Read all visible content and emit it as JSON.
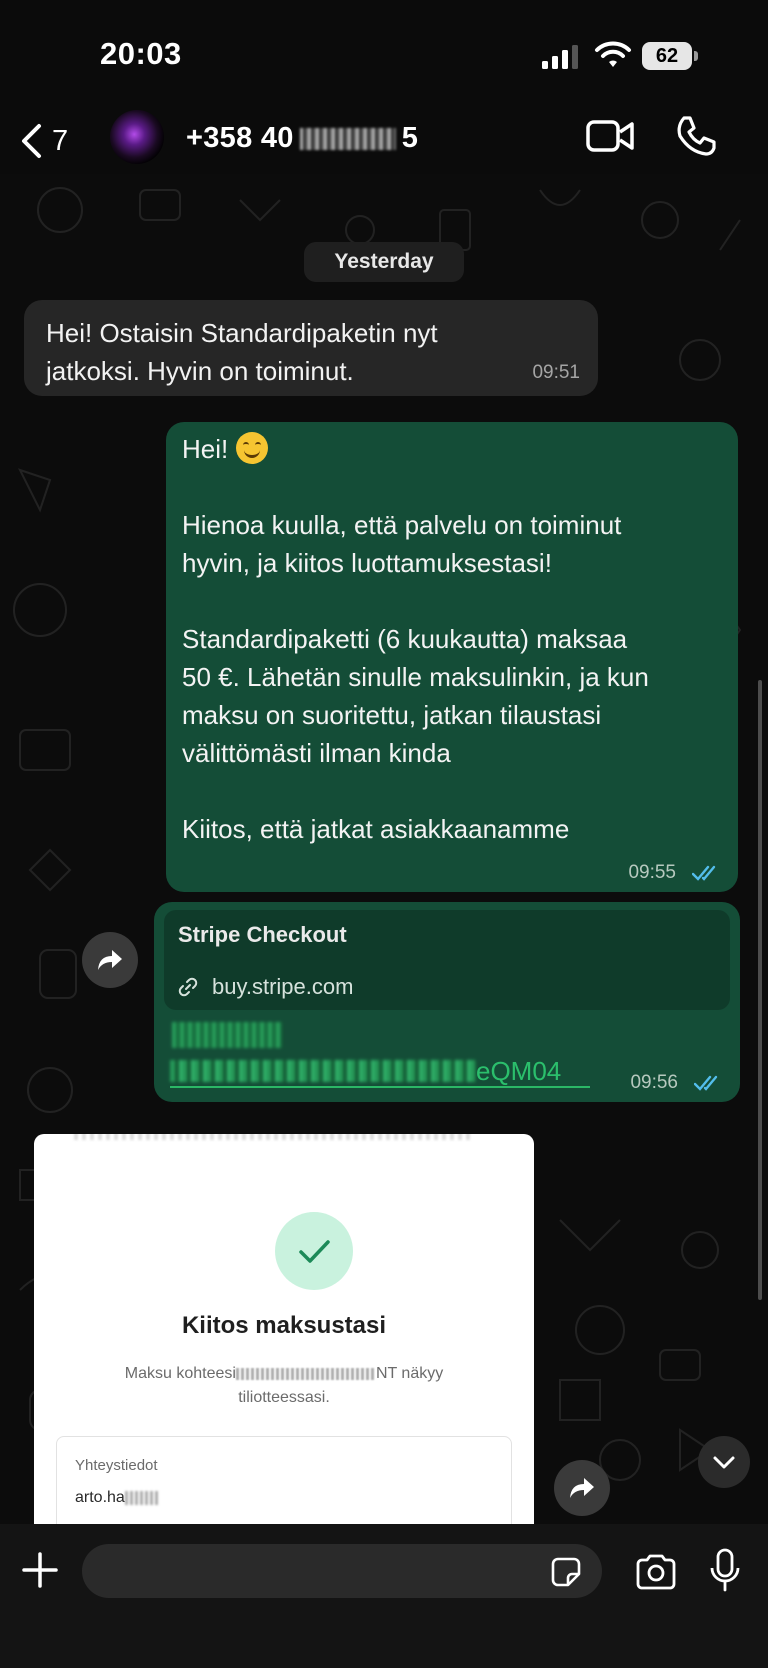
{
  "status_bar": {
    "time": "20:03",
    "battery_level": "62"
  },
  "header": {
    "back_count": "7",
    "contact_visible_prefix": "+358 40",
    "contact_visible_suffix": "5"
  },
  "date_separator": "Yesterday",
  "messages": [
    {
      "direction": "incoming",
      "lines": [
        "Hei! Ostaisin Standardipaketin nyt",
        "jatkoksi.  Hyvin on toiminut."
      ],
      "time": "09:51"
    },
    {
      "direction": "outgoing",
      "greeting": "Hei!",
      "lines": [
        "Hienoa kuulla, että palvelu on toiminut",
        "hyvin, ja kiitos luottamuksestasi!",
        "Standardipaketti (6 kuukautta) maksaa",
        "50 €. Lähetän sinulle maksulinkin, ja kun",
        "maksu on suoritettu, jatkan tilaustasi",
        "välittömästi ilman kinda",
        "Kiitos, että jatkat asiakkaanamme"
      ],
      "time": "09:55",
      "status": "read"
    },
    {
      "direction": "outgoing",
      "link_title": "Stripe Checkout",
      "link_domain": "buy.stripe.com",
      "url_visible_tail": "eQM04",
      "time": "09:56",
      "status": "read"
    }
  ],
  "receipt": {
    "title": "Kiitos maksustasi",
    "desc_prefix": "Maksu kohteesi",
    "desc_suffix": "NT näkyy",
    "desc_line2": "tiliotteessasi.",
    "contact_label": "Yhteystiedot",
    "contact_value": "arto.ha"
  },
  "colors": {
    "incoming_bubble": "#262626",
    "outgoing_bubble": "#144d37",
    "read_check": "#53bdeb",
    "link_green": "#2bbf6c"
  },
  "icons": [
    "back-icon",
    "avatar",
    "video-camera-icon",
    "phone-icon",
    "forward-icon",
    "chevron-down-icon",
    "plus-icon",
    "sticker-icon",
    "camera-icon",
    "microphone-icon",
    "link-icon",
    "check-icon",
    "double-check-icon"
  ]
}
